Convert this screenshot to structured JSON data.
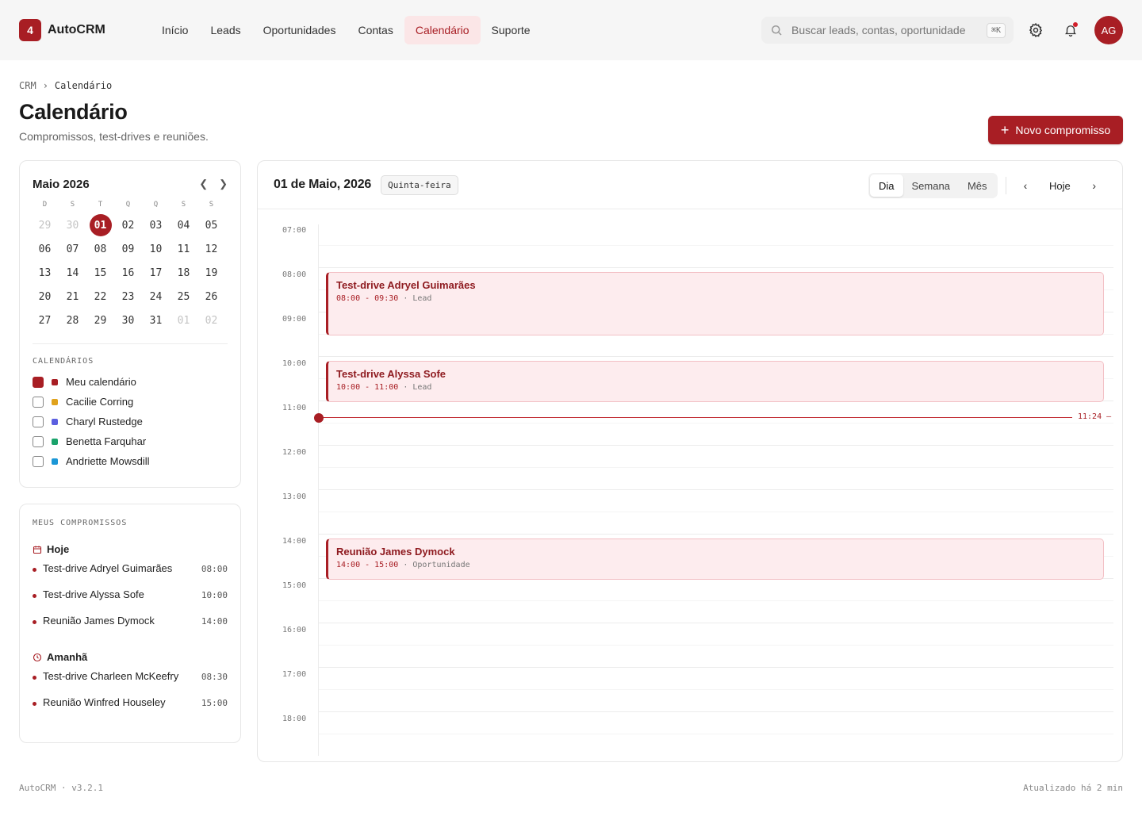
{
  "app": {
    "logo_badge": "4",
    "name": "AutoCRM"
  },
  "nav": [
    {
      "label": "Início",
      "active": false
    },
    {
      "label": "Leads",
      "active": false
    },
    {
      "label": "Oportunidades",
      "active": false
    },
    {
      "label": "Contas",
      "active": false
    },
    {
      "label": "Calendário",
      "active": true
    },
    {
      "label": "Suporte",
      "active": false
    }
  ],
  "search": {
    "placeholder": "Buscar leads, contas, oportunidade",
    "shortcut": "⌘K"
  },
  "user": {
    "initials": "AG"
  },
  "breadcrumb": {
    "root": "CRM",
    "current": "Calendário"
  },
  "page": {
    "title": "Calendário",
    "subtitle": "Compromissos, test-drives e reuniões.",
    "new_button": "Novo compromisso"
  },
  "mini_calendar": {
    "title": "Maio 2026",
    "weekdays": [
      "D",
      "S",
      "T",
      "Q",
      "Q",
      "S",
      "S"
    ],
    "days": [
      {
        "d": "29",
        "muted": true
      },
      {
        "d": "30",
        "muted": true
      },
      {
        "d": "01",
        "today": true
      },
      {
        "d": "02"
      },
      {
        "d": "03"
      },
      {
        "d": "04"
      },
      {
        "d": "05"
      },
      {
        "d": "06"
      },
      {
        "d": "07"
      },
      {
        "d": "08"
      },
      {
        "d": "09"
      },
      {
        "d": "10"
      },
      {
        "d": "11"
      },
      {
        "d": "12"
      },
      {
        "d": "13"
      },
      {
        "d": "14"
      },
      {
        "d": "15"
      },
      {
        "d": "16"
      },
      {
        "d": "17"
      },
      {
        "d": "18"
      },
      {
        "d": "19"
      },
      {
        "d": "20"
      },
      {
        "d": "21"
      },
      {
        "d": "22"
      },
      {
        "d": "23"
      },
      {
        "d": "24"
      },
      {
        "d": "25"
      },
      {
        "d": "26"
      },
      {
        "d": "27"
      },
      {
        "d": "28"
      },
      {
        "d": "29"
      },
      {
        "d": "30"
      },
      {
        "d": "31"
      },
      {
        "d": "01",
        "muted": true
      },
      {
        "d": "02",
        "muted": true
      }
    ]
  },
  "calendars": {
    "label": "CALENDÁRIOS",
    "items": [
      {
        "name": "Meu calendário",
        "checked": true,
        "color": "#a81e24"
      },
      {
        "name": "Cacilie Corring",
        "checked": false,
        "color": "#e0a21c"
      },
      {
        "name": "Charyl Rustedge",
        "checked": false,
        "color": "#5b5fe0"
      },
      {
        "name": "Benetta Farquhar",
        "checked": false,
        "color": "#1aa36b"
      },
      {
        "name": "Andriette Mowsdill",
        "checked": false,
        "color": "#1c97d6"
      }
    ]
  },
  "my_appointments": {
    "label": "MEUS COMPROMISSOS",
    "today_label": "Hoje",
    "today": [
      {
        "title": "Test-drive Adryel Guimarães",
        "time": "08:00"
      },
      {
        "title": "Test-drive Alyssa Sofe",
        "time": "10:00"
      },
      {
        "title": "Reunião James Dymock",
        "time": "14:00"
      }
    ],
    "tomorrow_label": "Amanhã",
    "tomorrow": [
      {
        "title": "Test-drive Charleen McKeefry",
        "time": "08:30"
      },
      {
        "title": "Reunião Winfred Houseley",
        "time": "15:00"
      }
    ]
  },
  "day_view": {
    "date": "01 de Maio, 2026",
    "weekday": "Quinta-feira",
    "views": [
      {
        "label": "Dia",
        "active": true
      },
      {
        "label": "Semana",
        "active": false
      },
      {
        "label": "Mês",
        "active": false
      }
    ],
    "today_button": "Hoje",
    "hours": [
      "07:00",
      "08:00",
      "09:00",
      "10:00",
      "11:00",
      "12:00",
      "13:00",
      "14:00",
      "15:00",
      "16:00",
      "17:00",
      "18:00"
    ],
    "now_label": "11:24",
    "events": [
      {
        "title": "Test-drive Adryel Guimarães",
        "range": "08:00 - 09:30",
        "kind": "Lead",
        "start": 8,
        "end": 9.5
      },
      {
        "title": "Test-drive Alyssa Sofe",
        "range": "10:00 - 11:00",
        "kind": "Lead",
        "start": 10,
        "end": 11
      },
      {
        "title": "Reunião James Dymock",
        "range": "14:00 - 15:00",
        "kind": "Oportunidade",
        "start": 14,
        "end": 15
      }
    ]
  },
  "footer": {
    "left": "AutoCRM · v3.2.1",
    "right": "Atualizado há 2 min"
  }
}
